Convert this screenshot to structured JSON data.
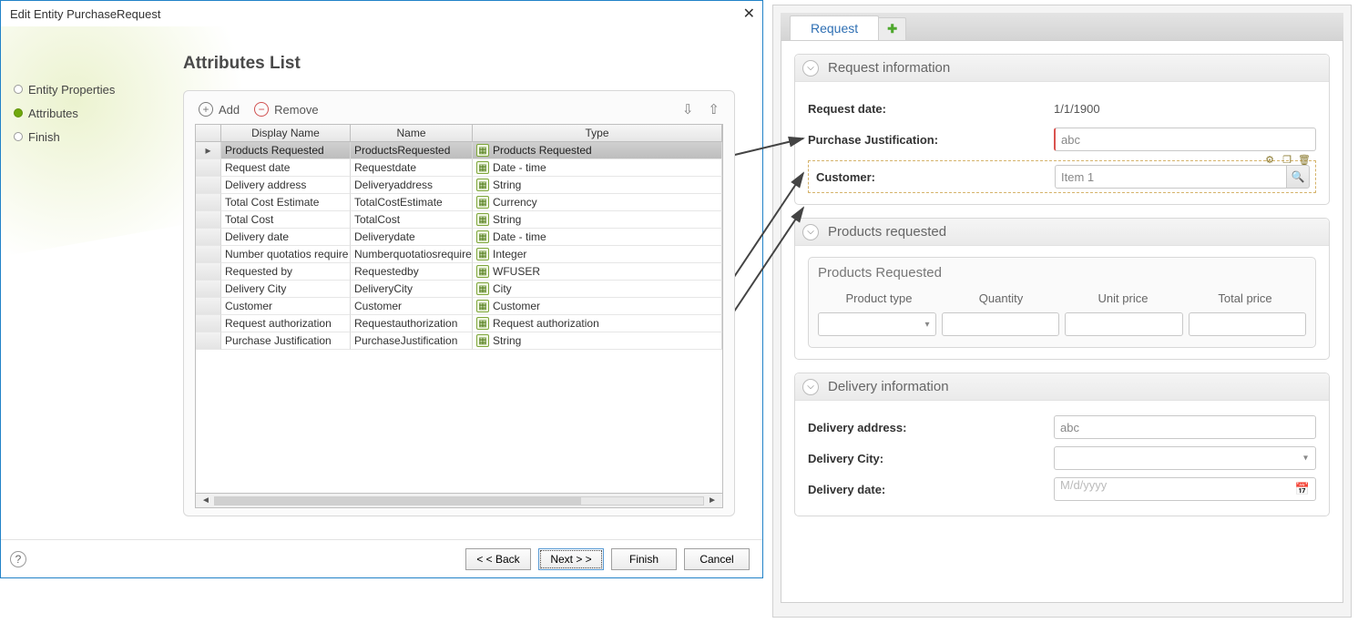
{
  "dialog": {
    "title": "Edit Entity PurchaseRequest",
    "nav": {
      "step_entity": "Entity Properties",
      "step_attributes": "Attributes",
      "step_finish": "Finish"
    },
    "section_title": "Attributes List",
    "toolbar": {
      "add": "Add",
      "remove": "Remove"
    },
    "columns": {
      "display": "Display Name",
      "name": "Name",
      "type": "Type"
    },
    "rows": [
      {
        "display": "Products Requested",
        "name": "ProductsRequested",
        "type": "Products Requested",
        "selected": true
      },
      {
        "display": "Request date",
        "name": "Requestdate",
        "type": "Date - time"
      },
      {
        "display": "Delivery address",
        "name": "Deliveryaddress",
        "type": "String"
      },
      {
        "display": "Total Cost Estimate",
        "name": "TotalCostEstimate",
        "type": "Currency"
      },
      {
        "display": "Total Cost",
        "name": "TotalCost",
        "type": "String"
      },
      {
        "display": "Delivery date",
        "name": "Deliverydate",
        "type": "Date - time"
      },
      {
        "display": "Number quotatios require",
        "name": "Numberquotatiosrequired",
        "type": "Integer"
      },
      {
        "display": "Requested by",
        "name": "Requestedby",
        "type": "WFUSER"
      },
      {
        "display": "Delivery City",
        "name": "DeliveryCity",
        "type": "City"
      },
      {
        "display": "Customer",
        "name": "Customer",
        "type": "Customer"
      },
      {
        "display": "Request authorization",
        "name": "Requestauthorization",
        "type": "Request authorization"
      },
      {
        "display": "Purchase Justification",
        "name": "PurchaseJustification",
        "type": "String"
      }
    ],
    "buttons": {
      "back": "< < Back",
      "next": "Next > >",
      "finish": "Finish",
      "cancel": "Cancel"
    }
  },
  "form": {
    "tab": "Request",
    "groups": {
      "reqinfo": {
        "title": "Request information",
        "request_date_label": "Request date:",
        "request_date_value": "1/1/1900",
        "justification_label": "Purchase Justification:",
        "justification_value": "abc",
        "customer_label": "Customer:",
        "customer_value": "Item 1"
      },
      "products": {
        "title": "Products requested",
        "sub_title": "Products Requested",
        "cols": {
          "ptype": "Product type",
          "qty": "Quantity",
          "uprice": "Unit price",
          "tprice": "Total price"
        }
      },
      "delivery": {
        "title": "Delivery information",
        "addr_label": "Delivery address:",
        "addr_value": "abc",
        "city_label": "Delivery City:",
        "date_label": "Delivery date:",
        "date_placeholder": "M/d/yyyy"
      }
    }
  }
}
